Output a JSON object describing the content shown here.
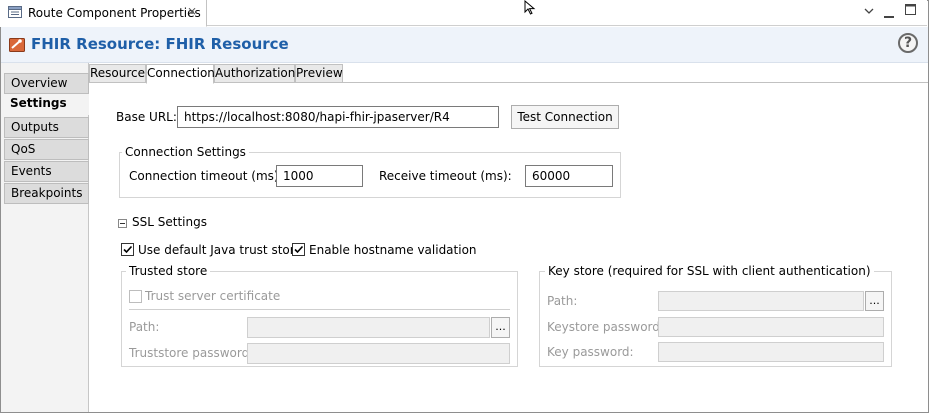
{
  "view_tab": {
    "title": "Route Component Properties",
    "icons": [
      "properties-icon",
      "close-icon",
      "view-menu-icon",
      "minimize-icon",
      "maximize-icon"
    ]
  },
  "header": {
    "title": "FHIR Resource: FHIR Resource",
    "help": "?"
  },
  "side_tabs": [
    "Overview",
    "Settings",
    "Outputs",
    "QoS",
    "Events",
    "Breakpoints"
  ],
  "active_side_tab": "Settings",
  "top_tabs": [
    "Resource",
    "Connection",
    "Authorization",
    "Preview"
  ],
  "active_top_tab": "Connection",
  "base_url": {
    "label": "Base URL:",
    "value": "https://localhost:8080/hapi-fhir-jpaserver/R4",
    "test_button": "Test Connection"
  },
  "connection_settings": {
    "title": "Connection Settings",
    "connection_timeout_label": "Connection timeout (ms):",
    "connection_timeout_value": "1000",
    "receive_timeout_label": "Receive timeout (ms):",
    "receive_timeout_value": "60000"
  },
  "ssl": {
    "title": "SSL Settings",
    "use_default_trust_store": {
      "label": "Use default Java trust store",
      "checked": true
    },
    "enable_hostname_validation": {
      "label": "Enable hostname validation",
      "checked": true
    },
    "trusted_store": {
      "title": "Trusted store",
      "trust_server_certificate": {
        "label": "Trust server certificate",
        "checked": false
      },
      "path_label": "Path:",
      "path_value": "",
      "browse": "...",
      "password_label": "Truststore password:",
      "password_value": ""
    },
    "key_store": {
      "title": "Key store (required for SSL with client authentication)",
      "path_label": "Path:",
      "path_value": "",
      "browse": "...",
      "keystore_password_label": "Keystore password:",
      "keystore_password_value": "",
      "key_password_label": "Key password:",
      "key_password_value": ""
    }
  },
  "colors": {
    "header_title": "#1f5fa8",
    "header_bg": "#eef3fa"
  }
}
